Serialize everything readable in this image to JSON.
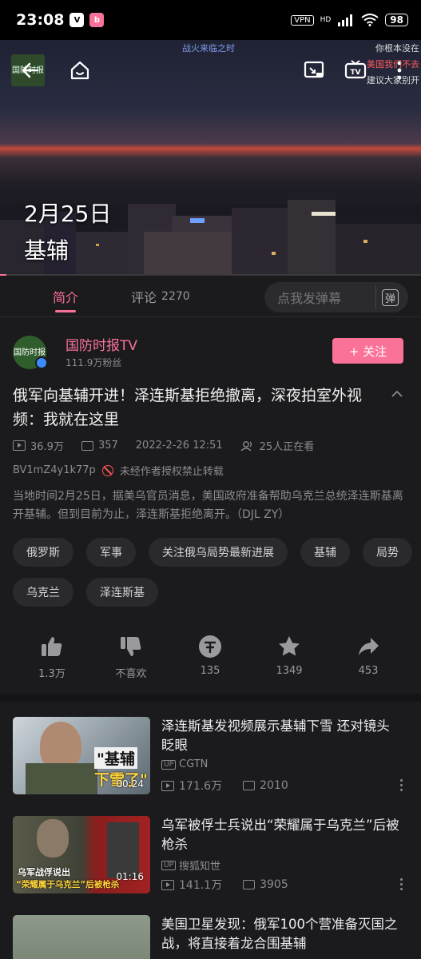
{
  "status_bar": {
    "time": "23:08",
    "vpn": "VPN",
    "hd": "HD",
    "battery": "98"
  },
  "video": {
    "channel_logo_text": "国防时报",
    "caption_line1": "2月25日",
    "caption_line2": "基辅",
    "danmaku_top": "战火来临之时",
    "danmaku_right_1": "你根本没在",
    "danmaku_right_2": "美国我们不去",
    "danmaku_right_3": "建议大家别开",
    "tv_label": "TV"
  },
  "tabs": {
    "intro": "简介",
    "comments": "评论",
    "comment_count": "2270",
    "danmaku_placeholder": "点我发弹幕",
    "danmaku_toggle": "弹"
  },
  "uploader": {
    "name": "国防时报TV",
    "fans": "111.9万粉丝",
    "follow": "+ 关注",
    "avatar_text": "国防时报"
  },
  "video_info": {
    "title": "俄军向基辅开进！泽连斯基拒绝撤离，深夜拍室外视频：我就在这里",
    "views": "36.9万",
    "danmaku_count": "357",
    "date": "2022-2-26 12:51",
    "watching": "25人正在看",
    "bvid": "BV1mZ4y1k77p",
    "no_repost": "未经作者授权禁止转载",
    "description": "当地时间2月25日，据美乌官员消息，美国政府准备帮助乌克兰总统泽连斯基离开基辅。但到目前为止，泽连斯基拒绝离开。（DJL ZY）"
  },
  "tags": [
    "俄罗斯",
    "军事",
    "关注俄乌局势最新进展",
    "基辅",
    "局势",
    "乌克兰",
    "泽连斯基"
  ],
  "actions": {
    "like": "1.3万",
    "dislike": "不喜欢",
    "coin": "135",
    "favorite": "1349",
    "share": "453"
  },
  "recommendations": [
    {
      "title": "泽连斯基发视频展示基辅下雪 还对镜头眨眼",
      "uploader": "CGTN",
      "views": "171.6万",
      "danmaku": "2010",
      "duration": "00:24",
      "thumb_text_1": "\"基辅",
      "thumb_text_2": "下雪了\""
    },
    {
      "title": "乌军被俘士兵说出“荣耀属于乌克兰”后被枪杀",
      "uploader": "搜狐知世",
      "views": "141.1万",
      "danmaku": "3905",
      "duration": "01:16",
      "thumb_text_1": "乌军战俘说出",
      "thumb_text_2": "“荣耀属于乌克兰”后被枪杀"
    },
    {
      "title": "美国卫星发现：俄军100个营准备灭国之战，将直接着龙合围基辅",
      "uploader": "",
      "views": "",
      "danmaku": "",
      "duration": "",
      "thumb_text_1": "",
      "thumb_text_2": ""
    }
  ],
  "colors": {
    "accent": "#fb7299",
    "background": "#1b1b1d"
  }
}
